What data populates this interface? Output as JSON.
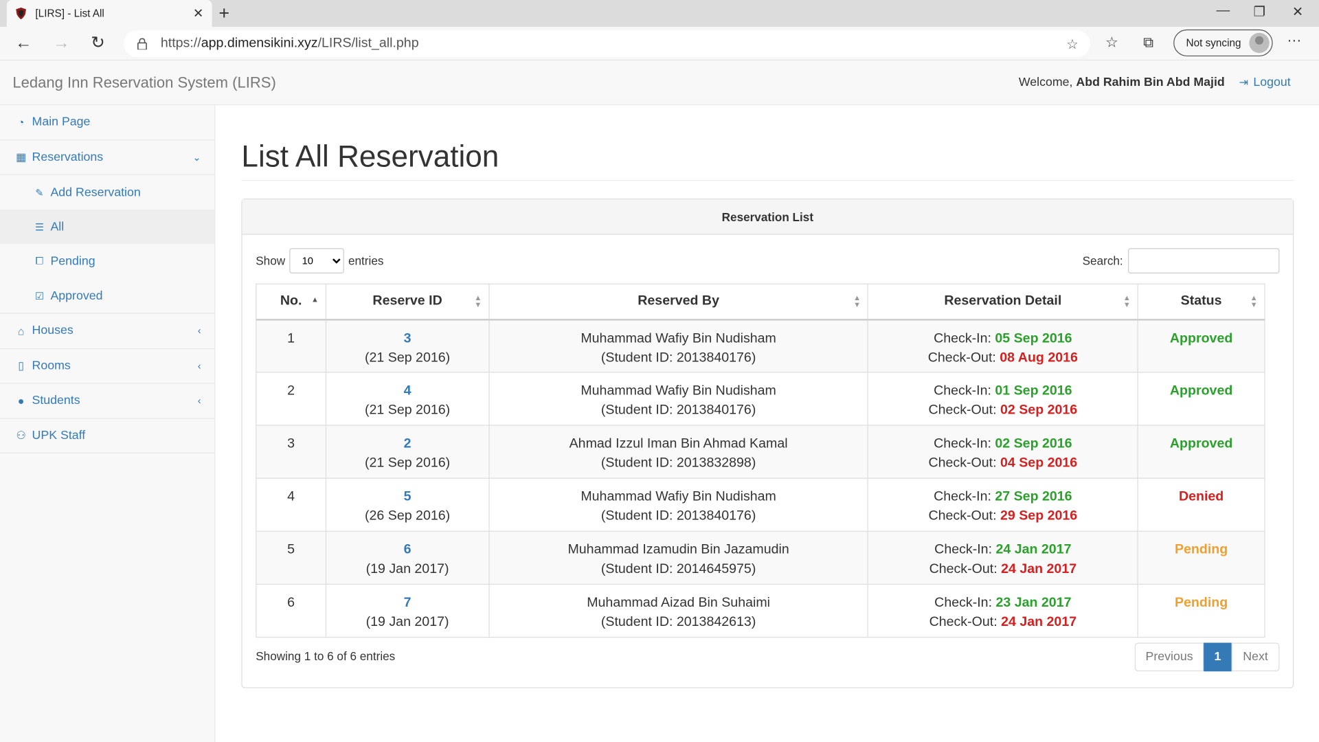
{
  "browser": {
    "tab_title": "[LIRS] - List All",
    "tab_close": "✕",
    "new_tab": "+",
    "url_scheme": "https://",
    "url_host": "app.dimensikini.xyz",
    "url_path": "/LIRS/list_all.php",
    "sync_label": "Not syncing",
    "window_controls": {
      "minimize": "—",
      "restore": "❐",
      "close": "✕"
    },
    "nav": {
      "back": "←",
      "forward": "→",
      "reload": "↻",
      "more": "···"
    }
  },
  "header": {
    "brand": "Ledang Inn Reservation System (LIRS)",
    "welcome_prefix": "Welcome, ",
    "user_name": "Abd Rahim Bin Abd Majid",
    "logout_label": "Logout"
  },
  "sidebar": {
    "main_page": "Main Page",
    "reservations": "Reservations",
    "add_reservation": "Add Reservation",
    "all": "All",
    "pending": "Pending",
    "approved": "Approved",
    "houses": "Houses",
    "rooms": "Rooms",
    "students": "Students",
    "upk_staff": "UPK Staff"
  },
  "main": {
    "page_title": "List All Reservation",
    "panel_title": "Reservation List",
    "show_label": "Show",
    "entries_label": "entries",
    "page_length": "10",
    "search_label": "Search:",
    "columns": {
      "no": "No.",
      "reserve_id": "Reserve ID",
      "reserved_by": "Reserved By",
      "detail": "Reservation Detail",
      "status": "Status"
    },
    "checkin_label": "Check-In: ",
    "checkout_label": "Check-Out: ",
    "rows": [
      {
        "no": "1",
        "id": "3",
        "date": "(21 Sep 2016)",
        "name": "Muhammad Wafiy Bin Nudisham",
        "student": "(Student ID: 2013840176)",
        "checkin": "05 Sep 2016",
        "checkout": "08 Aug 2016",
        "status": "Approved"
      },
      {
        "no": "2",
        "id": "4",
        "date": "(21 Sep 2016)",
        "name": "Muhammad Wafiy Bin Nudisham",
        "student": "(Student ID: 2013840176)",
        "checkin": "01 Sep 2016",
        "checkout": "02 Sep 2016",
        "status": "Approved"
      },
      {
        "no": "3",
        "id": "2",
        "date": "(21 Sep 2016)",
        "name": "Ahmad Izzul Iman Bin Ahmad Kamal",
        "student": "(Student ID: 2013832898)",
        "checkin": "02 Sep 2016",
        "checkout": "04 Sep 2016",
        "status": "Approved"
      },
      {
        "no": "4",
        "id": "5",
        "date": "(26 Sep 2016)",
        "name": "Muhammad Wafiy Bin Nudisham",
        "student": "(Student ID: 2013840176)",
        "checkin": "27 Sep 2016",
        "checkout": "29 Sep 2016",
        "status": "Denied"
      },
      {
        "no": "5",
        "id": "6",
        "date": "(19 Jan 2017)",
        "name": "Muhammad Izamudin Bin Jazamudin",
        "student": "(Student ID: 2014645975)",
        "checkin": "24 Jan 2017",
        "checkout": "24 Jan 2017",
        "status": "Pending"
      },
      {
        "no": "6",
        "id": "7",
        "date": "(19 Jan 2017)",
        "name": "Muhammad Aizad Bin Suhaimi",
        "student": "(Student ID: 2013842613)",
        "checkin": "23 Jan 2017",
        "checkout": "24 Jan 2017",
        "status": "Pending"
      }
    ],
    "info_text": "Showing 1 to 6 of 6 entries",
    "pager": {
      "previous": "Previous",
      "current": "1",
      "next": "Next"
    }
  },
  "colors": {
    "link": "#337ab7",
    "approved": "#2ca02c",
    "denied": "#d62020",
    "pending": "#f0a030"
  }
}
